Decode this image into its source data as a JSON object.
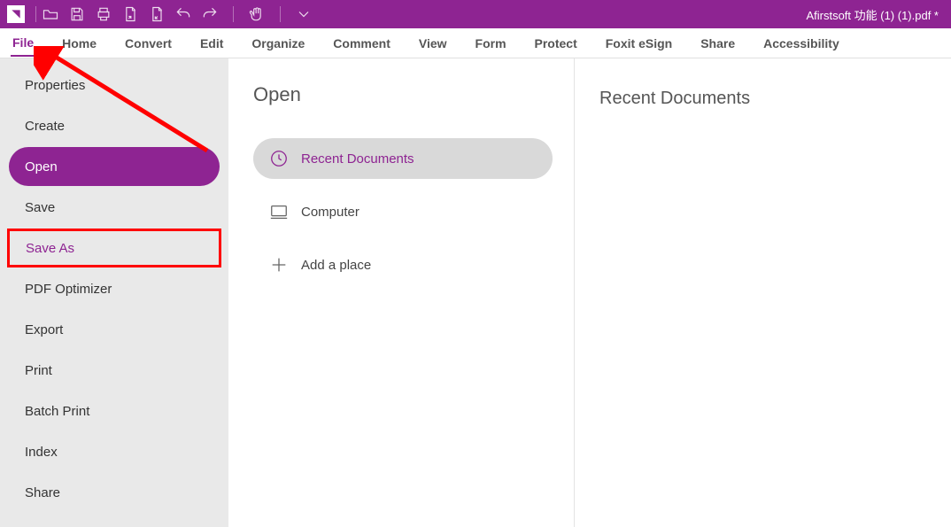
{
  "titlebar": {
    "document_title": "Afirstsoft 功能 (1) (1).pdf *"
  },
  "menubar": {
    "items": [
      {
        "label": "File",
        "active": true
      },
      {
        "label": "Home",
        "active": false
      },
      {
        "label": "Convert",
        "active": false
      },
      {
        "label": "Edit",
        "active": false
      },
      {
        "label": "Organize",
        "active": false
      },
      {
        "label": "Comment",
        "active": false
      },
      {
        "label": "View",
        "active": false
      },
      {
        "label": "Form",
        "active": false
      },
      {
        "label": "Protect",
        "active": false
      },
      {
        "label": "Foxit eSign",
        "active": false
      },
      {
        "label": "Share",
        "active": false
      },
      {
        "label": "Accessibility",
        "active": false
      }
    ]
  },
  "sidebar": {
    "items": [
      {
        "label": "Properties",
        "state": "normal"
      },
      {
        "label": "Create",
        "state": "normal"
      },
      {
        "label": "Open",
        "state": "selected"
      },
      {
        "label": "Save",
        "state": "normal"
      },
      {
        "label": "Save As",
        "state": "highlighted"
      },
      {
        "label": "PDF Optimizer",
        "state": "normal"
      },
      {
        "label": "Export",
        "state": "normal"
      },
      {
        "label": "Print",
        "state": "normal"
      },
      {
        "label": "Batch Print",
        "state": "normal"
      },
      {
        "label": "Index",
        "state": "normal"
      },
      {
        "label": "Share",
        "state": "normal"
      }
    ]
  },
  "open_panel": {
    "title": "Open",
    "items": [
      {
        "label": "Recent Documents",
        "icon": "clock-icon",
        "selected": true
      },
      {
        "label": "Computer",
        "icon": "computer-icon",
        "selected": false
      },
      {
        "label": "Add a place",
        "icon": "plus-icon",
        "selected": false
      }
    ]
  },
  "right_panel": {
    "title": "Recent Documents"
  },
  "annotation": {
    "target": "save-as",
    "origin": "file-menu",
    "shape": "arrow",
    "color": "#ff0000"
  },
  "colors": {
    "brand": "#8e2492",
    "sidebar_bg": "#e9e9e9",
    "highlight": "#ff0000"
  }
}
